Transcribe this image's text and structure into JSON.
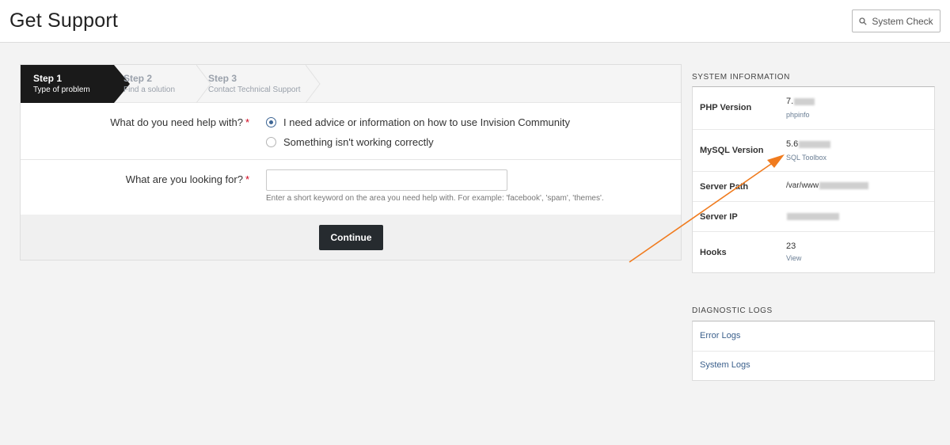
{
  "header": {
    "title": "Get Support",
    "system_check_label": "System Check"
  },
  "wizard": {
    "steps": [
      {
        "title": "Step 1",
        "subtitle": "Type of problem"
      },
      {
        "title": "Step 2",
        "subtitle": "Find a solution"
      },
      {
        "title": "Step 3",
        "subtitle": "Contact Technical Support"
      }
    ]
  },
  "form": {
    "help_question": "What do you need help with?",
    "options": [
      {
        "label": "I need advice or information on how to use Invision Community",
        "checked": true
      },
      {
        "label": "Something isn't working correctly",
        "checked": false
      }
    ],
    "keyword_question": "What are you looking for?",
    "required_mark": "*",
    "keyword_value": "",
    "keyword_help": "Enter a short keyword on the area you need help with. For example: 'facebook', 'spam', 'themes'.",
    "continue_label": "Continue"
  },
  "system_info": {
    "title": "SYSTEM INFORMATION",
    "rows": [
      {
        "key": "PHP Version",
        "value": "7.",
        "link": "phpinfo"
      },
      {
        "key": "MySQL Version",
        "value": "5.6",
        "link": "SQL Toolbox"
      },
      {
        "key": "Server Path",
        "value": "/var/www",
        "link": ""
      },
      {
        "key": "Server IP",
        "value": "",
        "link": ""
      },
      {
        "key": "Hooks",
        "value": "23",
        "link": "View"
      }
    ]
  },
  "diagnostic_logs": {
    "title": "DIAGNOSTIC LOGS",
    "items": [
      "Error Logs",
      "System Logs"
    ]
  },
  "colors": {
    "annotation_arrow": "#f07b1e",
    "link": "#3a5f8b",
    "active_step": "#1a1a1a"
  }
}
